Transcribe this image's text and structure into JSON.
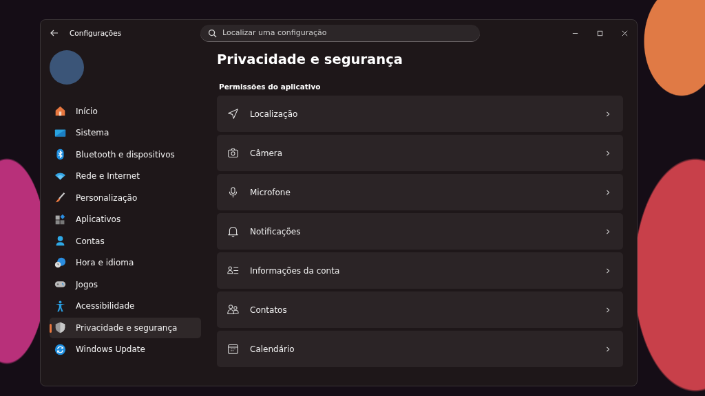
{
  "window": {
    "title": "Configurações"
  },
  "search": {
    "placeholder": "Localizar uma configuração"
  },
  "sidebar": {
    "items": [
      {
        "label": "Início",
        "selected": false
      },
      {
        "label": "Sistema",
        "selected": false
      },
      {
        "label": "Bluetooth e dispositivos",
        "selected": false
      },
      {
        "label": "Rede e Internet",
        "selected": false
      },
      {
        "label": "Personalização",
        "selected": false
      },
      {
        "label": "Aplicativos",
        "selected": false
      },
      {
        "label": "Contas",
        "selected": false
      },
      {
        "label": "Hora e idioma",
        "selected": false
      },
      {
        "label": "Jogos",
        "selected": false
      },
      {
        "label": "Acessibilidade",
        "selected": false
      },
      {
        "label": "Privacidade e segurança",
        "selected": true
      },
      {
        "label": "Windows Update",
        "selected": false
      }
    ]
  },
  "page": {
    "title": "Privacidade e segurança",
    "section": "Permissões do aplicativo",
    "rows": [
      {
        "label": "Localização"
      },
      {
        "label": "Câmera"
      },
      {
        "label": "Microfone"
      },
      {
        "label": "Notificações"
      },
      {
        "label": "Informações da conta"
      },
      {
        "label": "Contatos"
      },
      {
        "label": "Calendário"
      }
    ]
  }
}
